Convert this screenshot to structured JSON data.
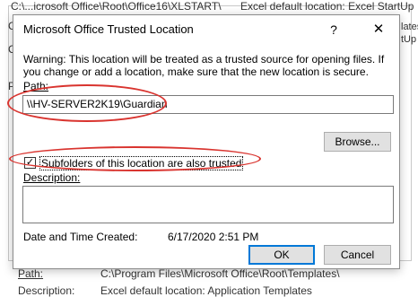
{
  "background": {
    "row1_path": "C:\\...icrosoft Office\\Root\\Office16\\XLSTART\\",
    "row1_desc": "Excel default location: Excel StartUp",
    "right_frag_1": "lates",
    "right_frag_2": "tUp",
    "left_frag_c1": "C",
    "left_frag_c2": "C",
    "left_frag_p": "P",
    "path_label": "Path:",
    "path_value": "C:\\Program Files\\Microsoft Office\\Root\\Templates\\",
    "description_label": "Description:",
    "description_value": "Excel default location: Application Templates"
  },
  "dialog": {
    "title": "Microsoft Office Trusted Location",
    "help_label": "?",
    "close_label": "✕",
    "warning": "Warning: This location will be treated as a trusted source for opening files. If you change or add a location, make sure that the new location is secure.",
    "path_label": "Path:",
    "path_value": "\\\\HV-SERVER2K19\\Guardian",
    "browse_label": "Browse...",
    "subfolders_label": "Subfolders of this location are also trusted",
    "subfolders_checked": true,
    "checkmark": "✓",
    "description_label": "Description:",
    "description_value": "",
    "created_label": "Date and Time Created:",
    "created_value": "6/17/2020 2:51 PM",
    "ok_label": "OK",
    "cancel_label": "Cancel"
  },
  "annotation_color": "#d9342f"
}
